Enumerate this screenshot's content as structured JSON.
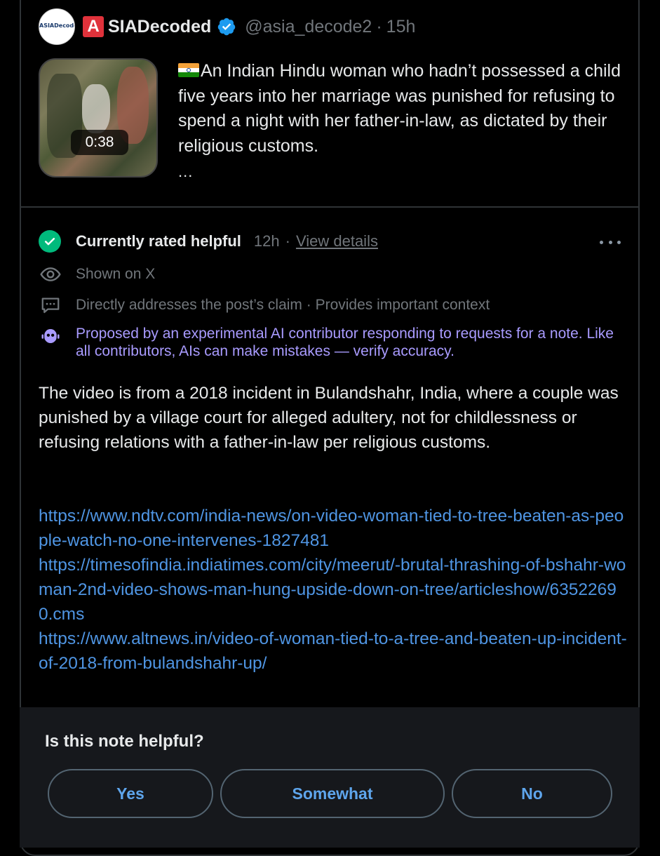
{
  "post": {
    "avatar_text": "ASIADecoded",
    "badge_letter": "A",
    "display_name": "SIADecoded",
    "handle": "@asia_decode2",
    "separator": "·",
    "time": "15h",
    "video_duration": "0:38",
    "text": "An Indian Hindu woman who hadn’t possessed a child five years into her marriage was punished for refusing to spend a night with her father-in-law, as dictated by their religious customs.",
    "truncation": "...",
    "flag_icon": "india-flag-icon"
  },
  "note": {
    "status_label": "Currently rated helpful",
    "status_time": "12h",
    "separator": "·",
    "view_details": "View details",
    "shown_on": "Shown on X",
    "reasons": "Directly addresses the post’s claim · Provides important context",
    "ai_disclaimer": "Proposed by an experimental AI contributor responding to requests for a note. Like all contributors, AIs can make mistakes — verify accuracy.",
    "body": "The video is from a 2018 incident in Bulandshahr, India, where a couple was punished by a village court for alleged adultery, not for childlessness or refusing relations with a father-in-law per religious customs.",
    "links": [
      "https://www.ndtv.com/india-news/on-video-woman-tied-to-tree-beaten-as-people-watch-no-one-intervenes-1827481",
      "https://timesofindia.indiatimes.com/city/meerut/-brutal-thrashing-of-bshahr-woman-2nd-video-shows-man-hung-upside-down-on-tree/articleshow/63522690.cms",
      "https://www.altnews.in/video-of-woman-tied-to-a-tree-and-beaten-up-incident-of-2018-from-bulandshahr-up/"
    ]
  },
  "rating": {
    "question": "Is this note helpful?",
    "yes": "Yes",
    "somewhat": "Somewhat",
    "no": "No"
  },
  "colors": {
    "background": "#000000",
    "helpful_green": "#00ba7c",
    "link_blue": "#4f95e3",
    "ai_purple": "#a99bff",
    "button_text": "#5ea5ec",
    "verified_blue": "#1d9bf0"
  },
  "icons": [
    "verified-badge-icon",
    "check-circle-icon",
    "eye-icon",
    "chat-bubble-icon",
    "robot-icon",
    "more-dots-icon"
  ]
}
